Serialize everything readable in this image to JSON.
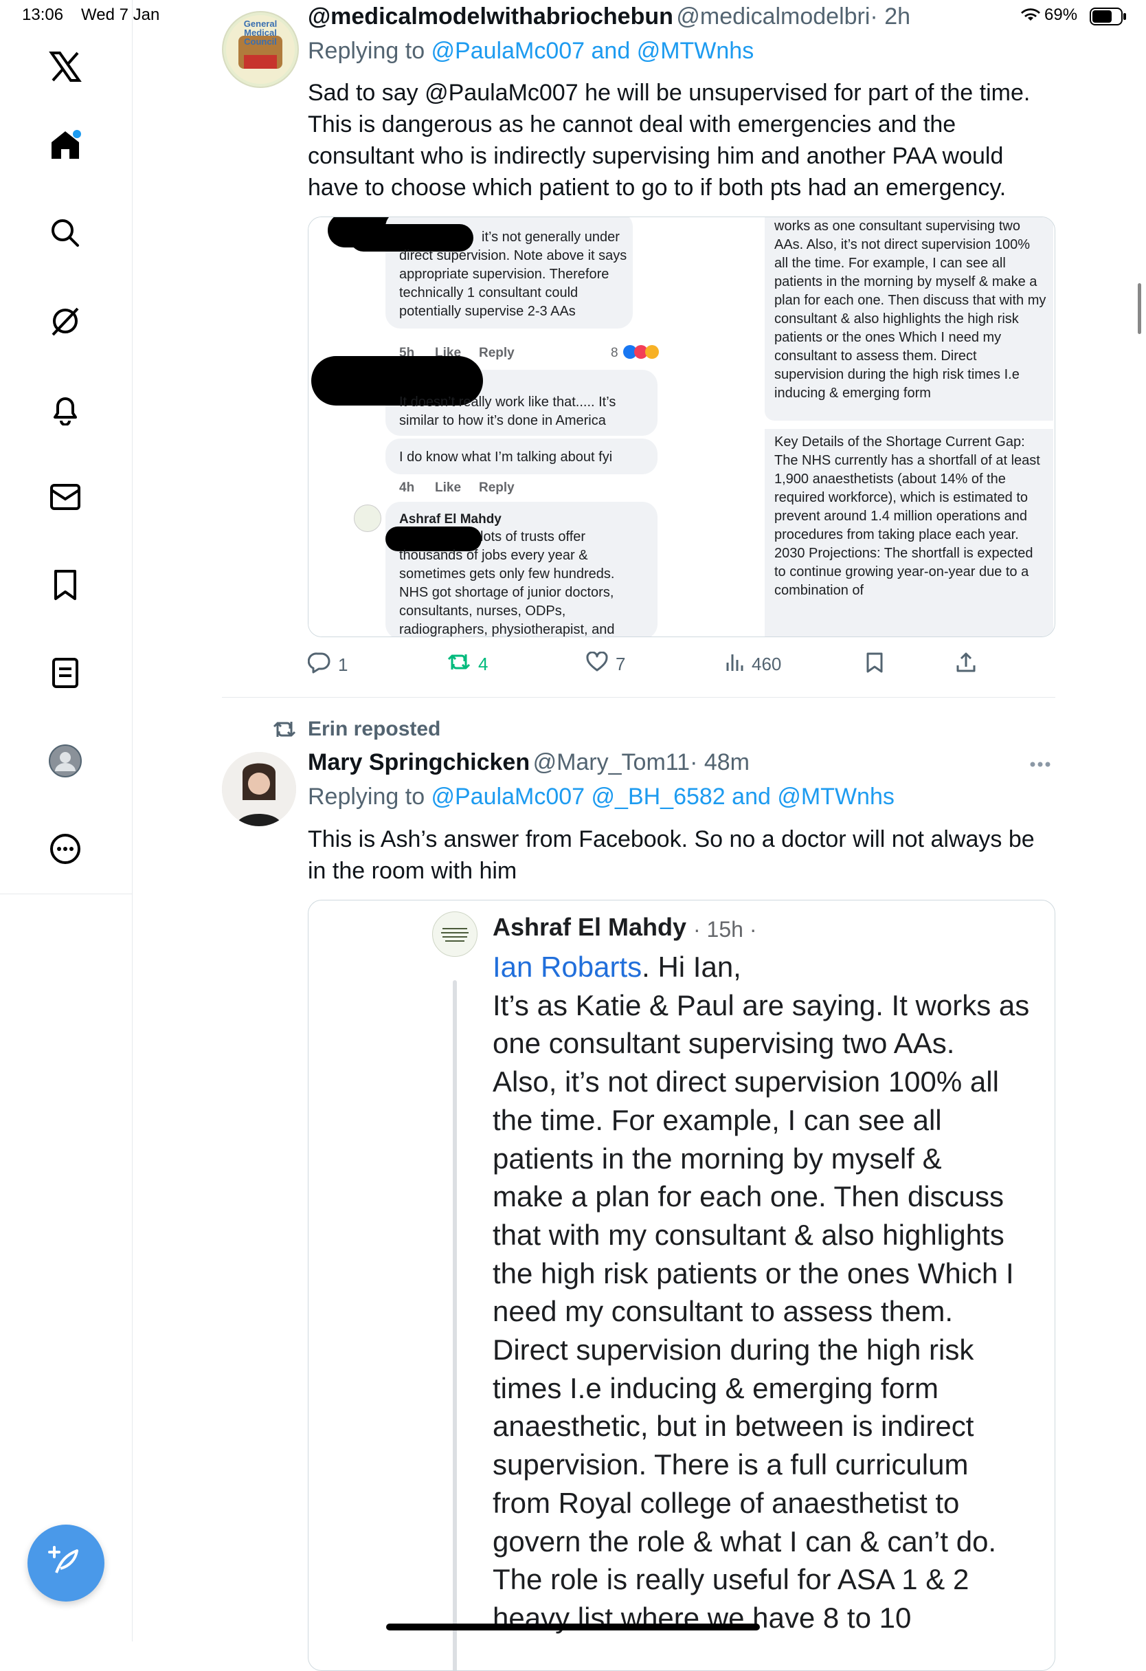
{
  "status_bar": {
    "time": "13:06",
    "date": "Wed 7 Jan",
    "battery": "69%"
  },
  "sidebar": {
    "items": [
      {
        "icon": "x-logo-icon"
      },
      {
        "icon": "home-icon"
      },
      {
        "icon": "search-icon"
      },
      {
        "icon": "grok-icon"
      },
      {
        "icon": "bell-icon"
      },
      {
        "icon": "mail-icon"
      },
      {
        "icon": "bookmark-icon"
      },
      {
        "icon": "list-icon"
      },
      {
        "icon": "profile-icon"
      },
      {
        "icon": "more-icon"
      }
    ],
    "compose_icon": "compose-icon",
    "accent": "#1d9bf0"
  },
  "tweet1": {
    "name": "@medicalmodelwithabriochebun",
    "handle": "@medicalmodelbri",
    "time": "· 2h",
    "replying_prefix": "Replying to ",
    "replying_mentions": "@PaulaMc007 and @MTWnhs",
    "text": "Sad to say @PaulaMc007 he will be unsupervised for part of the time. This is dangerous as he cannot deal with emergencies and the consultant who is indirectly  supervising him and another PAA would have to choose which patient to go to if both pts had an emergency.",
    "avatar_text": "General Medical Council",
    "media_left": {
      "bubble1": "it’s not generally under direct supervision. Note above it says appropriate supervision. Therefore technically 1 consultant could potentially supervise 2-3 AAs",
      "meta1": {
        "time": "5h",
        "like": "Like",
        "reply": "Reply",
        "count": "8"
      },
      "bubble2": "It doesn’t really work like that..... It’s similar to how it’s done in America",
      "bubble3": "I do know what I’m talking about fyi",
      "meta2": {
        "time": "4h",
        "like": "Like",
        "reply": "Reply"
      },
      "author4": "Ashraf El Mahdy",
      "bubble4": "lots of trusts offer thousands of jobs every year & sometimes gets only few hundreds. NHS got shortage of junior doctors, consultants, nurses, ODPs, radiographers, physiotherapist, and"
    },
    "media_right": {
      "top": "works as one consultant supervising two AAs. Also, it’s not direct supervision 100% all the time. For example, I can see all patients in the morning by myself & make a plan for each one. Then discuss that with my consultant & also highlights the high risk patients or the ones Which I need my consultant to assess them. Direct supervision during the high risk times I.e inducing & emerging form",
      "bottom": "Key Details of the Shortage Current Gap: The NHS currently has a shortfall of at least 1,900 anaesthetists (about 14% of the required workforce), which is estimated to prevent around 1.4 million operations and procedures from taking place each year. 2030 Projections: The shortfall is expected to continue growing year-on-year due to a combination of"
    },
    "actions": {
      "replies": "1",
      "reposts": "4",
      "likes": "7",
      "views": "460"
    }
  },
  "tweet2": {
    "reposted_by": "Erin reposted",
    "name": "Mary Springchicken",
    "handle": "@Mary_Tom11",
    "time": "· 48m",
    "replying_prefix": "Replying to ",
    "replying_mentions": "@PaulaMc007 @_BH_6582 and @MTWnhs",
    "text": "This is Ash’s answer from Facebook. So no a doctor will not always be in the room with him",
    "media": {
      "author": "Ashraf El Mahdy",
      "time": "· 15h ·",
      "mention": "Ian Robarts",
      "lines": [
        ". Hi Ian,",
        "It’s as Katie & Paul are saying. It works as",
        "one consultant supervising two AAs.",
        "Also, it’s not direct supervision 100% all",
        "the time. For example, I can see all",
        "patients in the morning by myself &",
        "make a plan for each one. Then discuss",
        "that with my consultant & also highlights",
        "the high risk patients or the ones Which I",
        "need my consultant to assess them.",
        "Direct supervision during the high risk",
        "times I.e inducing & emerging form",
        "anaesthetic, but in between is indirect",
        "supervision. There is a full curriculum",
        "from Royal college of anaesthetist to",
        "govern the role & what I can & can’t do.",
        "The role is really useful for ASA 1 & 2",
        "heavy list where we have 8 to 10"
      ]
    }
  }
}
